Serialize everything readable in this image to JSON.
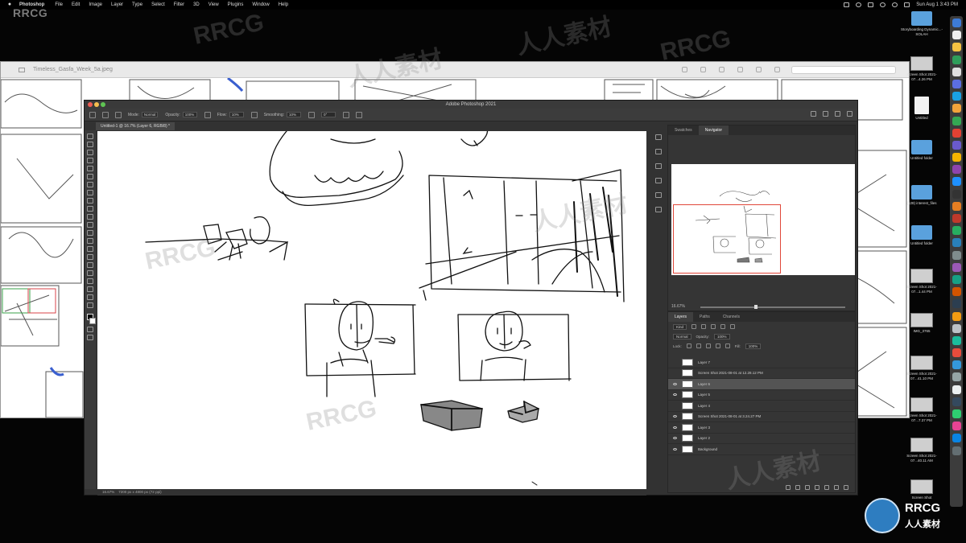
{
  "menubar": {
    "app_name": "Photoshop",
    "items": [
      "File",
      "Edit",
      "Image",
      "Layer",
      "Type",
      "Select",
      "Filter",
      "3D",
      "View",
      "Plugins",
      "Window",
      "Help"
    ],
    "clock": "Sun Aug 1  3:43 PM"
  },
  "watermark_logo": "RRCG",
  "preview_window": {
    "title": "Timeless_Gasfa_Week_5a.jpeg"
  },
  "photoshop": {
    "window_title": "Adobe Photoshop 2021",
    "options": {
      "mode_label": "Mode:",
      "mode_value": "Normal",
      "opacity_label": "Opacity:",
      "opacity_value": "100%",
      "flow_label": "Flow:",
      "flow_value": "10%",
      "smoothing_label": "Smoothing:",
      "smoothing_value": "10%",
      "angle_value": "0°"
    },
    "document_tab": "Untitled-1 @ 16.7% (Layer 6, RGB/8) *",
    "status_zoom": "16.67%",
    "status_size": "7200 px x 4800 px (72 ppi)",
    "navigator": {
      "tabs": [
        "Swatches",
        "Navigator"
      ],
      "active_tab": "Navigator",
      "zoom": "16.67%",
      "zoom_fraction": 0.38
    },
    "layers": {
      "tabs": [
        "Layers",
        "Paths",
        "Channels"
      ],
      "active_tab": "Layers",
      "kind_label": "Kind",
      "blend_mode": "Normal",
      "opacity_label": "Opacity:",
      "opacity_value": "100%",
      "lock_label": "Lock:",
      "fill_label": "Fill:",
      "fill_value": "100%",
      "items": [
        {
          "name": "Layer 7",
          "visible": false,
          "selected": false
        },
        {
          "name": "Screen Shot 2021-08-01 at 12.28.12 PM",
          "visible": false,
          "selected": false
        },
        {
          "name": "Layer 6",
          "visible": true,
          "selected": true
        },
        {
          "name": "Layer 5",
          "visible": true,
          "selected": false
        },
        {
          "name": "Layer 4",
          "visible": false,
          "selected": false
        },
        {
          "name": "Screen Shot 2021-08-01 at 3.24.27 PM",
          "visible": true,
          "selected": false
        },
        {
          "name": "Layer 3",
          "visible": true,
          "selected": false
        },
        {
          "name": "Layer 2",
          "visible": true,
          "selected": false
        },
        {
          "name": "Background",
          "visible": true,
          "selected": false
        }
      ]
    }
  },
  "desktop": {
    "items": [
      {
        "label": "Storyboarding Dynamic...-SOLAH",
        "type": "folder"
      },
      {
        "label": "Screen Shot 2021-07...4.26 PM",
        "type": "shot"
      },
      {
        "label": "Untitled",
        "type": "file"
      },
      {
        "label": "Untitled folder",
        "type": "folder"
      },
      {
        "label": "(128) interest_files",
        "type": "folder"
      },
      {
        "label": "Untitled folder",
        "type": "folder"
      },
      {
        "label": "Screen Shot 2021-07...1.44 PM",
        "type": "shot"
      },
      {
        "label": "IMG_3765",
        "type": "shot"
      },
      {
        "label": "Screen Shot 2021-07...41.10 PM",
        "type": "shot"
      },
      {
        "label": "Screen Shot 2021-07...7.37 PM",
        "type": "shot"
      },
      {
        "label": "Screen Shot 2021-07...40.11 AM",
        "type": "shot"
      },
      {
        "label": "Screen Shot",
        "type": "shot"
      }
    ]
  },
  "dock_apps": [
    "#3d7bd6",
    "#f0f0f0",
    "#f5c242",
    "#2f9e5a",
    "#e0e0e0",
    "#5b6ee1",
    "#1aa1e5",
    "#f2a33a",
    "#34a853",
    "#e34133",
    "#6a5acd",
    "#f4b400",
    "#8e44ad",
    "#1e90ff",
    "#333333",
    "#e67e22",
    "#c0392b",
    "#27ae60",
    "#2980b9",
    "#7f8c8d",
    "#9b59b6",
    "#16a085",
    "#d35400",
    "#2c3e50",
    "#f39c12",
    "#bdc3c7",
    "#1abc9c",
    "#e74c3c",
    "#3498db",
    "#95a5a6",
    "#ecf0f1",
    "#34495e",
    "#2ecc71",
    "#e84393",
    "#0984e3",
    "#636e72"
  ],
  "rrcg_logo": {
    "title": "RRCG",
    "subtitle": "人人素材"
  },
  "watermarks": [
    "RRCG",
    "人人素材",
    "RRCG",
    "人人素材",
    "RRCG",
    "人人素材",
    "RRCG",
    "人人素材"
  ]
}
